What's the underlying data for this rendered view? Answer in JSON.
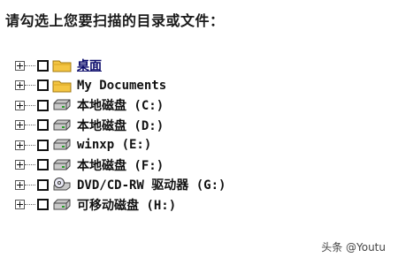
{
  "prompt": "请勾选上您要扫描的目录或文件：",
  "items": [
    {
      "label": "桌面",
      "icon": "folder-icon",
      "selected": true
    },
    {
      "label": "My Documents",
      "icon": "folder-icon",
      "selected": false
    },
    {
      "label": "本地磁盘 (C:)",
      "icon": "hard-drive-icon",
      "selected": false
    },
    {
      "label": "本地磁盘 (D:)",
      "icon": "hard-drive-icon",
      "selected": false
    },
    {
      "label": "winxp (E:)",
      "icon": "hard-drive-icon",
      "selected": false
    },
    {
      "label": "本地磁盘 (F:)",
      "icon": "hard-drive-icon",
      "selected": false
    },
    {
      "label": "DVD/CD-RW 驱动器 (G:)",
      "icon": "cd-drive-icon",
      "selected": false
    },
    {
      "label": "可移动磁盘 (H:)",
      "icon": "hard-drive-icon",
      "selected": false
    }
  ],
  "watermark": "头条 @Youtu"
}
